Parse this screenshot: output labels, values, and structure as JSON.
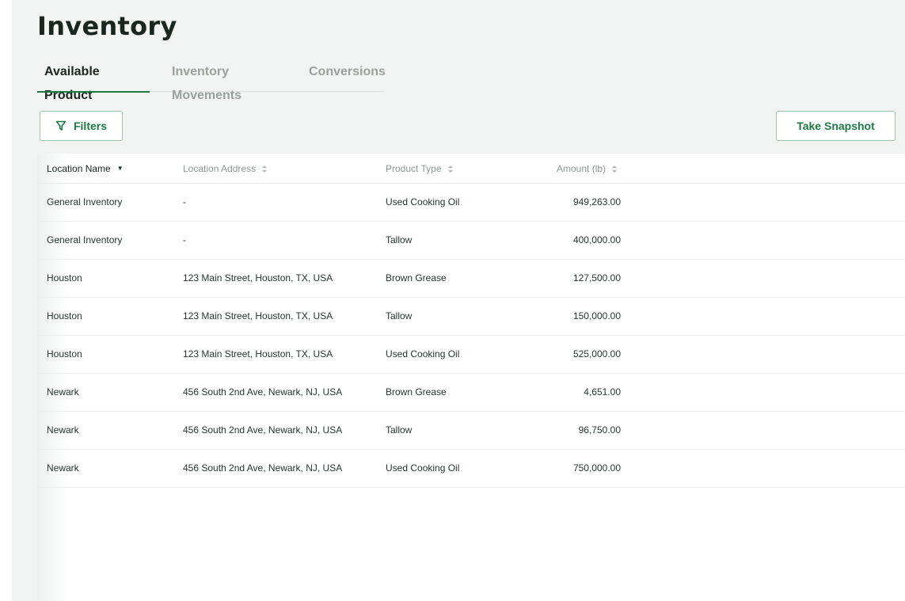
{
  "page": {
    "title": "Inventory"
  },
  "tabs": [
    {
      "label": "Available Product",
      "active": true
    },
    {
      "label": "Inventory Movements",
      "active": false
    },
    {
      "label": "Conversions",
      "active": false
    }
  ],
  "toolbar": {
    "filters_label": "Filters",
    "snapshot_label": "Take Snapshot"
  },
  "colors": {
    "accent": "#1e7a45",
    "panel": "#f2f4f3",
    "button_border": "#9cc7ad"
  },
  "table": {
    "columns": [
      {
        "label": "Location Name",
        "sort": "desc"
      },
      {
        "label": "Location Address",
        "sort": "none"
      },
      {
        "label": "Product Type",
        "sort": "none"
      },
      {
        "label": "Amount (lb)",
        "sort": "none"
      }
    ],
    "rows": [
      [
        "General Inventory",
        "-",
        "Used Cooking Oil",
        "949,263.00"
      ],
      [
        "General Inventory",
        "-",
        "Tallow",
        "400,000.00"
      ],
      [
        "Houston",
        "123 Main Street, Houston, TX, USA",
        "Brown Grease",
        "127,500.00"
      ],
      [
        "Houston",
        "123 Main Street, Houston, TX, USA",
        "Tallow",
        "150,000.00"
      ],
      [
        "Houston",
        "123 Main Street, Houston, TX, USA",
        "Used Cooking Oil",
        "525,000.00"
      ],
      [
        "Newark",
        "456 South 2nd Ave, Newark, NJ, USA",
        "Brown Grease",
        "4,651.00"
      ],
      [
        "Newark",
        "456 South 2nd Ave, Newark, NJ, USA",
        "Tallow",
        "96,750.00"
      ],
      [
        "Newark",
        "456 South 2nd Ave, Newark, NJ, USA",
        "Used Cooking Oil",
        "750,000.00"
      ]
    ]
  }
}
